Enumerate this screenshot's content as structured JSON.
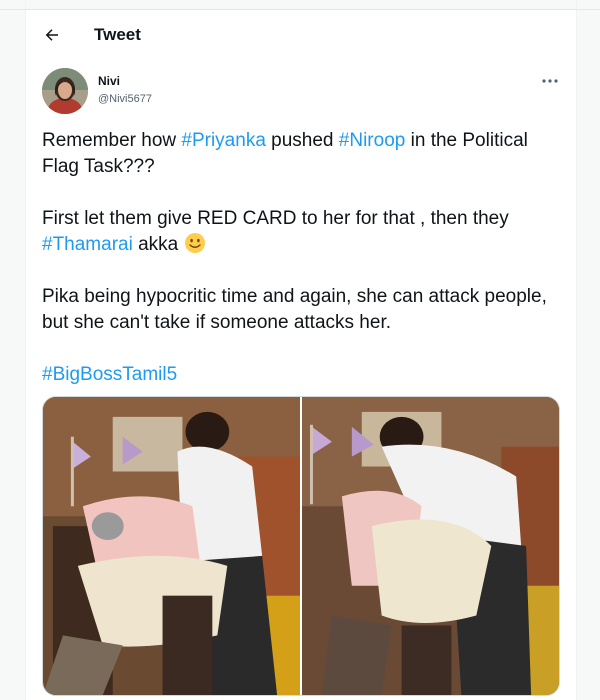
{
  "header": {
    "title": "Tweet",
    "back_icon": "arrow-left-icon"
  },
  "author": {
    "name": "Nivi",
    "handle": "@Nivi5677",
    "more_icon": "more-horizontal-icon"
  },
  "tweet": {
    "p1": {
      "t1": "Remember how ",
      "h1": "#Priyanka",
      "t2": " pushed ",
      "h2": "#Niroop",
      "t3": " in the Political Flag Task???"
    },
    "p2": {
      "t1": "First let them give RED CARD to her for that , then they ",
      "h1": "#Thamarai",
      "t2": " akka ",
      "emoji": "slightly-smiling-face-emoji"
    },
    "p3": {
      "t1": "Pika being hypocritic time and again, she can attack people, but she can't take if someone attacks her."
    },
    "p4": {
      "h1": "#BigBossTamil5"
    }
  },
  "media": {
    "count": 2
  },
  "colors": {
    "accent": "#1d9bf0",
    "text": "#0f1419",
    "secondary": "#536471"
  }
}
